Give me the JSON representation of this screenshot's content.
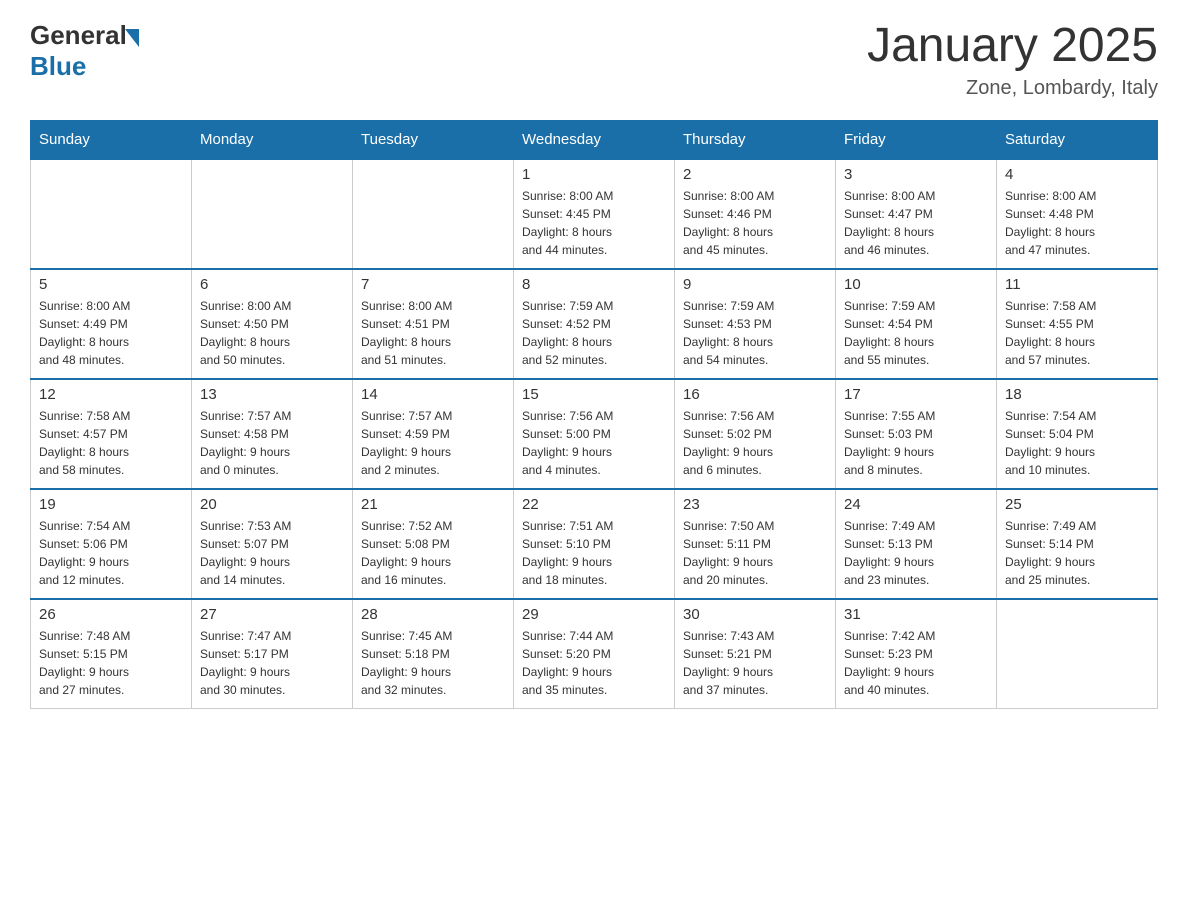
{
  "logo": {
    "general": "General",
    "blue": "Blue"
  },
  "title": "January 2025",
  "subtitle": "Zone, Lombardy, Italy",
  "days_header": [
    "Sunday",
    "Monday",
    "Tuesday",
    "Wednesday",
    "Thursday",
    "Friday",
    "Saturday"
  ],
  "weeks": [
    [
      {
        "day": "",
        "info": ""
      },
      {
        "day": "",
        "info": ""
      },
      {
        "day": "",
        "info": ""
      },
      {
        "day": "1",
        "info": "Sunrise: 8:00 AM\nSunset: 4:45 PM\nDaylight: 8 hours\nand 44 minutes."
      },
      {
        "day": "2",
        "info": "Sunrise: 8:00 AM\nSunset: 4:46 PM\nDaylight: 8 hours\nand 45 minutes."
      },
      {
        "day": "3",
        "info": "Sunrise: 8:00 AM\nSunset: 4:47 PM\nDaylight: 8 hours\nand 46 minutes."
      },
      {
        "day": "4",
        "info": "Sunrise: 8:00 AM\nSunset: 4:48 PM\nDaylight: 8 hours\nand 47 minutes."
      }
    ],
    [
      {
        "day": "5",
        "info": "Sunrise: 8:00 AM\nSunset: 4:49 PM\nDaylight: 8 hours\nand 48 minutes."
      },
      {
        "day": "6",
        "info": "Sunrise: 8:00 AM\nSunset: 4:50 PM\nDaylight: 8 hours\nand 50 minutes."
      },
      {
        "day": "7",
        "info": "Sunrise: 8:00 AM\nSunset: 4:51 PM\nDaylight: 8 hours\nand 51 minutes."
      },
      {
        "day": "8",
        "info": "Sunrise: 7:59 AM\nSunset: 4:52 PM\nDaylight: 8 hours\nand 52 minutes."
      },
      {
        "day": "9",
        "info": "Sunrise: 7:59 AM\nSunset: 4:53 PM\nDaylight: 8 hours\nand 54 minutes."
      },
      {
        "day": "10",
        "info": "Sunrise: 7:59 AM\nSunset: 4:54 PM\nDaylight: 8 hours\nand 55 minutes."
      },
      {
        "day": "11",
        "info": "Sunrise: 7:58 AM\nSunset: 4:55 PM\nDaylight: 8 hours\nand 57 minutes."
      }
    ],
    [
      {
        "day": "12",
        "info": "Sunrise: 7:58 AM\nSunset: 4:57 PM\nDaylight: 8 hours\nand 58 minutes."
      },
      {
        "day": "13",
        "info": "Sunrise: 7:57 AM\nSunset: 4:58 PM\nDaylight: 9 hours\nand 0 minutes."
      },
      {
        "day": "14",
        "info": "Sunrise: 7:57 AM\nSunset: 4:59 PM\nDaylight: 9 hours\nand 2 minutes."
      },
      {
        "day": "15",
        "info": "Sunrise: 7:56 AM\nSunset: 5:00 PM\nDaylight: 9 hours\nand 4 minutes."
      },
      {
        "day": "16",
        "info": "Sunrise: 7:56 AM\nSunset: 5:02 PM\nDaylight: 9 hours\nand 6 minutes."
      },
      {
        "day": "17",
        "info": "Sunrise: 7:55 AM\nSunset: 5:03 PM\nDaylight: 9 hours\nand 8 minutes."
      },
      {
        "day": "18",
        "info": "Sunrise: 7:54 AM\nSunset: 5:04 PM\nDaylight: 9 hours\nand 10 minutes."
      }
    ],
    [
      {
        "day": "19",
        "info": "Sunrise: 7:54 AM\nSunset: 5:06 PM\nDaylight: 9 hours\nand 12 minutes."
      },
      {
        "day": "20",
        "info": "Sunrise: 7:53 AM\nSunset: 5:07 PM\nDaylight: 9 hours\nand 14 minutes."
      },
      {
        "day": "21",
        "info": "Sunrise: 7:52 AM\nSunset: 5:08 PM\nDaylight: 9 hours\nand 16 minutes."
      },
      {
        "day": "22",
        "info": "Sunrise: 7:51 AM\nSunset: 5:10 PM\nDaylight: 9 hours\nand 18 minutes."
      },
      {
        "day": "23",
        "info": "Sunrise: 7:50 AM\nSunset: 5:11 PM\nDaylight: 9 hours\nand 20 minutes."
      },
      {
        "day": "24",
        "info": "Sunrise: 7:49 AM\nSunset: 5:13 PM\nDaylight: 9 hours\nand 23 minutes."
      },
      {
        "day": "25",
        "info": "Sunrise: 7:49 AM\nSunset: 5:14 PM\nDaylight: 9 hours\nand 25 minutes."
      }
    ],
    [
      {
        "day": "26",
        "info": "Sunrise: 7:48 AM\nSunset: 5:15 PM\nDaylight: 9 hours\nand 27 minutes."
      },
      {
        "day": "27",
        "info": "Sunrise: 7:47 AM\nSunset: 5:17 PM\nDaylight: 9 hours\nand 30 minutes."
      },
      {
        "day": "28",
        "info": "Sunrise: 7:45 AM\nSunset: 5:18 PM\nDaylight: 9 hours\nand 32 minutes."
      },
      {
        "day": "29",
        "info": "Sunrise: 7:44 AM\nSunset: 5:20 PM\nDaylight: 9 hours\nand 35 minutes."
      },
      {
        "day": "30",
        "info": "Sunrise: 7:43 AM\nSunset: 5:21 PM\nDaylight: 9 hours\nand 37 minutes."
      },
      {
        "day": "31",
        "info": "Sunrise: 7:42 AM\nSunset: 5:23 PM\nDaylight: 9 hours\nand 40 minutes."
      },
      {
        "day": "",
        "info": ""
      }
    ]
  ]
}
